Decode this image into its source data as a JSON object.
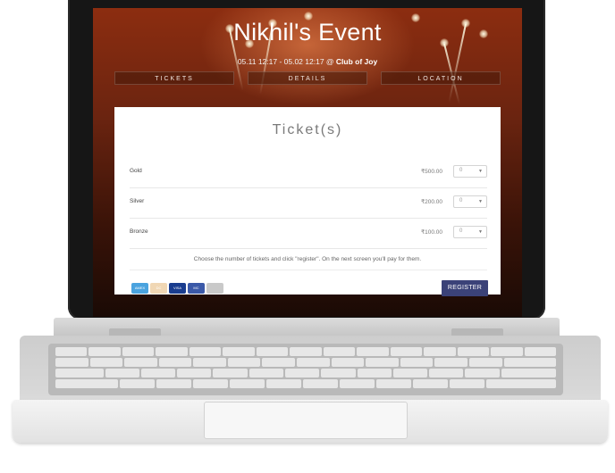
{
  "event": {
    "title": "Nikhil's Event",
    "dates": "05.11 12:17 - 05.02 12:17",
    "at": " @ ",
    "venue": "Club of Joy"
  },
  "tabs": [
    {
      "label": "TICKETS"
    },
    {
      "label": "DETAILS"
    },
    {
      "label": "LOCATION"
    }
  ],
  "tickets_card": {
    "title": "Ticket(s)",
    "rows": [
      {
        "name": "Gold",
        "price": "₹500.00",
        "quantity": "0"
      },
      {
        "name": "Silver",
        "price": "₹200.00",
        "quantity": "0"
      },
      {
        "name": "Bronze",
        "price": "₹100.00",
        "quantity": "0"
      }
    ],
    "note": "Choose the number of tickets and click \"register\". On the next screen you'll pay for them.",
    "register_label": "REGISTER",
    "payment_icons": [
      {
        "icon": "amex-card-icon",
        "label": "AMEX",
        "color": "#4aa3df"
      },
      {
        "icon": "diners-card-icon",
        "label": "DC",
        "color": "#f0d7b4"
      },
      {
        "icon": "visa-card-icon",
        "label": "VISA",
        "color": "#1a3d8f"
      },
      {
        "icon": "mastercard-icon",
        "label": "MC",
        "color": "#3b59a8"
      },
      {
        "icon": "generic-card-icon",
        "label": "",
        "color": "#c9c9c9"
      }
    ]
  },
  "colors": {
    "accent_button": "#3b4278",
    "card_background": "#ffffff"
  }
}
